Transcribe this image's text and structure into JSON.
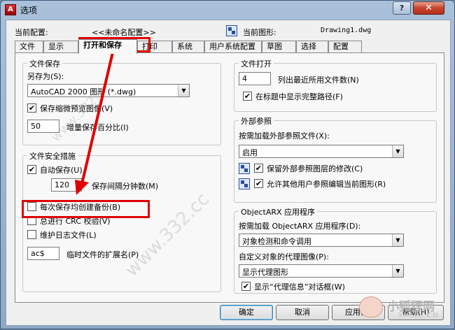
{
  "window": {
    "title": "选项",
    "help_glyph": "?",
    "close_glyph": "✕",
    "app_icon_glyph": "A"
  },
  "header": {
    "current_profile_label": "当前配置:",
    "current_profile_value": "<<未命名配置>>",
    "current_drawing_label": "当前图形:",
    "current_drawing_value": "Drawing1.dwg"
  },
  "tabs": [
    "文件",
    "显示",
    "打开和保存",
    "打印",
    "系统",
    "用户系统配置",
    "草图",
    "选择",
    "配置"
  ],
  "active_tab": "打开和保存",
  "file_save": {
    "legend": "文件保存",
    "save_as_label": "另存为(S):",
    "save_as_value": "AutoCAD 2000 图形 (*.dwg)",
    "thumbnail_label": "保存缩微预览图像(V)",
    "thumbnail_checked": true,
    "incremental_value": "50",
    "incremental_label": "增量保存百分比(I)"
  },
  "file_safety": {
    "legend": "文件安全措施",
    "autosave_label": "自动保存(U)",
    "autosave_checked": true,
    "minutes_value": "120",
    "minutes_label": "保存间隔分钟数(M)",
    "backup_label": "每次保存均创建备份(B)",
    "backup_checked": false,
    "crc_label": "总进行 CRC 校验(V)",
    "crc_checked": false,
    "log_label": "维护日志文件(L)",
    "log_checked": false,
    "temp_ext_value": "ac$",
    "temp_ext_label": "临时文件的扩展名(P)"
  },
  "file_open": {
    "legend": "文件打开",
    "recent_value": "4",
    "recent_label": "列出最近所用文件数(N)",
    "fullpath_label": "在标题中显示完整路径(F)",
    "fullpath_checked": true
  },
  "xref": {
    "legend": "外部参照",
    "demand_label": "按需加载外部参照文件(X):",
    "demand_value": "启用",
    "retain_label": "保留外部参照图层的修改(C)",
    "retain_checked": true,
    "allow_label": "允许其他用户参照编辑当前图形(R)",
    "allow_checked": true
  },
  "objectarx": {
    "legend": "ObjectARX 应用程序",
    "demand_label": "按需加载 ObjectARX 应用程序(D):",
    "demand_value": "对象检测和命令调用",
    "proxy_label": "自定义对象的代理图像(P):",
    "proxy_value": "显示代理图形",
    "proxy_info_label": "显示“代理信息”对话框(W)",
    "proxy_info_checked": true
  },
  "buttons": {
    "ok": "确定",
    "cancel": "取消",
    "apply": "应用(A)",
    "help": "帮助(H)"
  },
  "watermarks": {
    "site": "www.332.cc",
    "brand_name": "小狐狸网",
    "brand_domain": "XHLLS.CN"
  },
  "colors": {
    "annotation_red": "#e00000",
    "window_frame": "#a9c0da"
  }
}
